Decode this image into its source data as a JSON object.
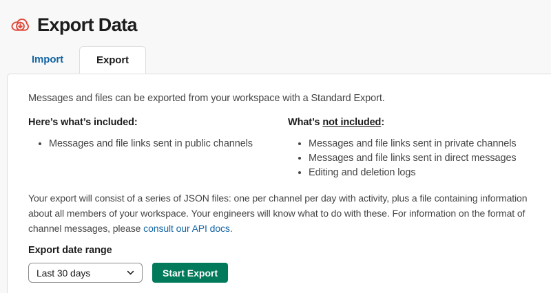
{
  "header": {
    "title": "Export Data",
    "icon": "cloud-download-icon"
  },
  "tabs": [
    {
      "label": "Import",
      "active": false
    },
    {
      "label": "Export",
      "active": true
    }
  ],
  "content": {
    "intro": "Messages and files can be exported from your workspace with a Standard Export.",
    "included": {
      "heading": "Here’s what’s included:",
      "items": [
        "Messages and file links sent in public channels"
      ]
    },
    "not_included": {
      "heading_prefix": "What’s ",
      "heading_underlined": "not included",
      "heading_suffix": ":",
      "items": [
        "Messages and file links sent in private channels",
        "Messages and file links sent in direct messages",
        "Editing and deletion logs"
      ]
    },
    "details": {
      "text_before_link": "Your export will consist of a series of JSON files: one per channel per day with activity, plus a file containing information about all members of your workspace. Your engineers will know what to do with these. For information on the format of channel messages, please ",
      "link_text": "consult our API docs",
      "text_after_link": "."
    },
    "export_range": {
      "label": "Export date range",
      "selected_option": "Last 30 days",
      "button_label": "Start Export"
    }
  },
  "colors": {
    "accent_red": "#e0493a",
    "link_blue": "#1264a3",
    "button_green": "#007a5a",
    "heading_text": "#1d1c1d",
    "body_text": "#454545",
    "panel_border": "#dddddd",
    "page_bg": "#f8f8f8",
    "panel_bg": "#ffffff"
  }
}
